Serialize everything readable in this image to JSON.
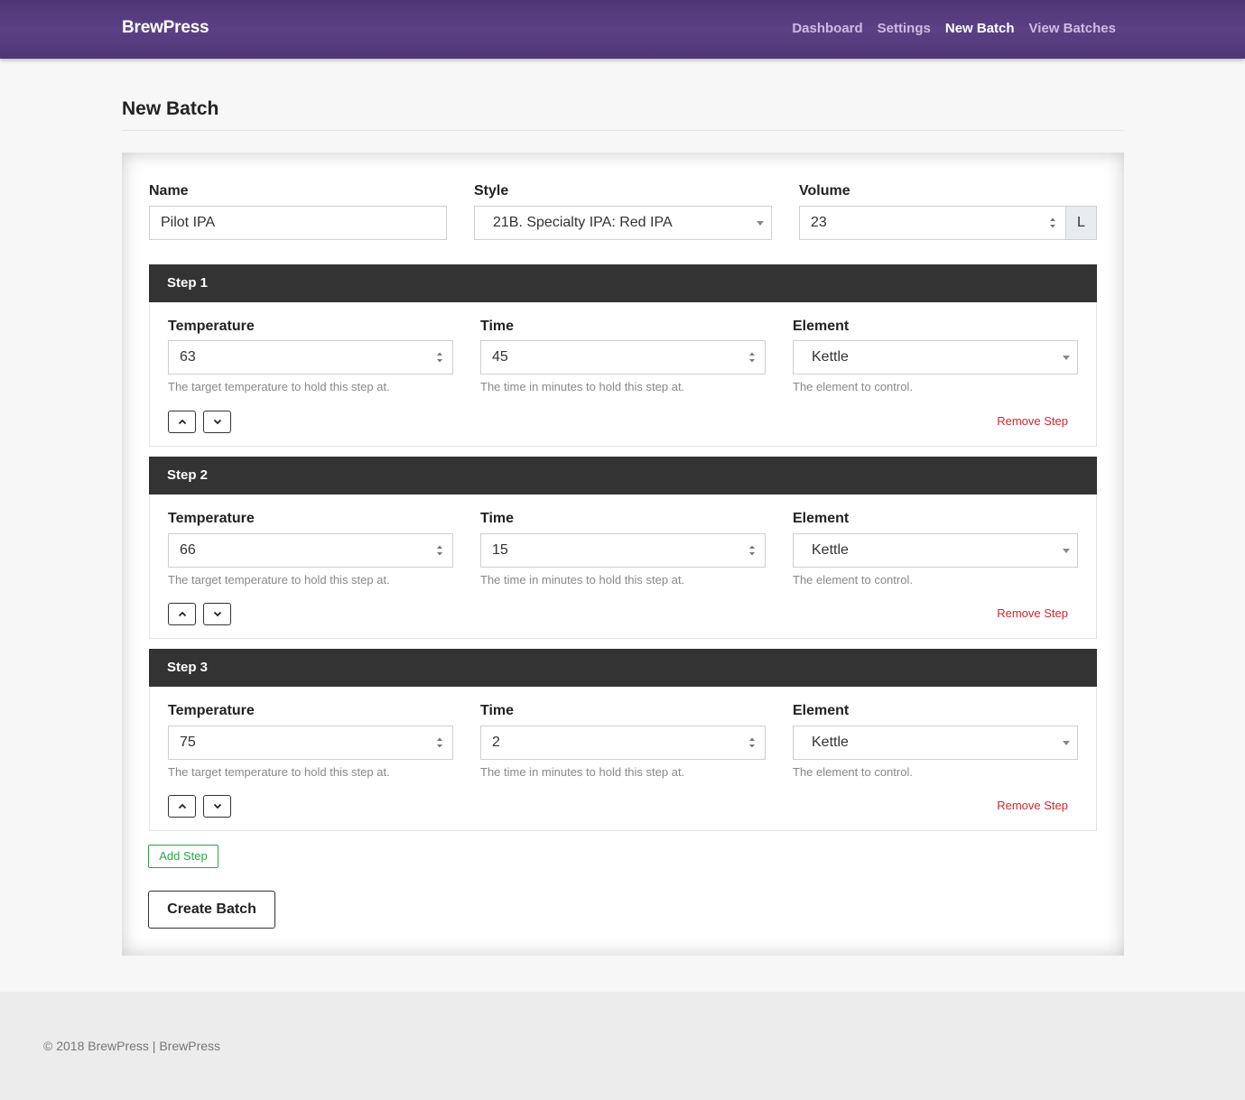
{
  "navbar": {
    "brand": "BrewPress",
    "links": [
      {
        "label": "Dashboard",
        "active": false
      },
      {
        "label": "Settings",
        "active": false
      },
      {
        "label": "New Batch",
        "active": true
      },
      {
        "label": "View Batches",
        "active": false
      }
    ]
  },
  "page": {
    "title": "New Batch"
  },
  "form": {
    "name_label": "Name",
    "name_value": "Pilot IPA",
    "style_label": "Style",
    "style_value": "21B. Specialty IPA: Red IPA",
    "volume_label": "Volume",
    "volume_value": "23",
    "volume_unit": "L"
  },
  "step_fields": {
    "temperature_label": "Temperature",
    "temperature_help": "The target temperature to hold this step at.",
    "time_label": "Time",
    "time_help": "The time in minutes to hold this step at.",
    "element_label": "Element",
    "element_help": "The element to control.",
    "remove_label": "Remove Step"
  },
  "steps": [
    {
      "title": "Step 1",
      "temperature": "63",
      "time": "45",
      "element": "Kettle"
    },
    {
      "title": "Step 2",
      "temperature": "66",
      "time": "15",
      "element": "Kettle"
    },
    {
      "title": "Step 3",
      "temperature": "75",
      "time": "2",
      "element": "Kettle"
    }
  ],
  "actions": {
    "add_step": "Add Step",
    "create_batch": "Create Batch"
  },
  "footer": {
    "text": "© 2018 BrewPress | BrewPress"
  },
  "colors": {
    "navbar": "#5b4185",
    "step_header": "#333333",
    "remove": "#d0282e",
    "add_step": "#28a745"
  }
}
